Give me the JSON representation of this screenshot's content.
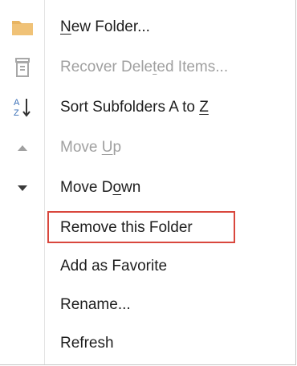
{
  "menu": {
    "items": [
      {
        "pre": "",
        "u": "N",
        "post": "ew Folder...",
        "icon": "folder-icon",
        "enabled": true
      },
      {
        "pre": "Recover Dele",
        "u": "t",
        "post": "ed Items...",
        "icon": "recycle-bin-icon",
        "enabled": false
      },
      {
        "pre": "Sort Subfolders A to ",
        "u": "Z",
        "post": "",
        "icon": "sort-az-icon",
        "enabled": true
      },
      {
        "pre": "Move ",
        "u": "U",
        "post": "p",
        "icon": "triangle-up-icon",
        "enabled": false
      },
      {
        "pre": "Move D",
        "u": "o",
        "post": "wn",
        "icon": "triangle-down-icon",
        "enabled": true
      },
      {
        "pre": "Remove this Folder",
        "u": "",
        "post": "",
        "icon": "",
        "enabled": true
      },
      {
        "pre": "Add as Favorite",
        "u": "",
        "post": "",
        "icon": "",
        "enabled": true
      },
      {
        "pre": "Rename...",
        "u": "",
        "post": "",
        "icon": "",
        "enabled": true
      },
      {
        "pre": "Refresh",
        "u": "",
        "post": "",
        "icon": "",
        "enabled": true
      }
    ],
    "colors": {
      "highlight_border": "#d9473d",
      "folder": "#e8b461",
      "disabled_text": "#a0a0a0"
    }
  }
}
